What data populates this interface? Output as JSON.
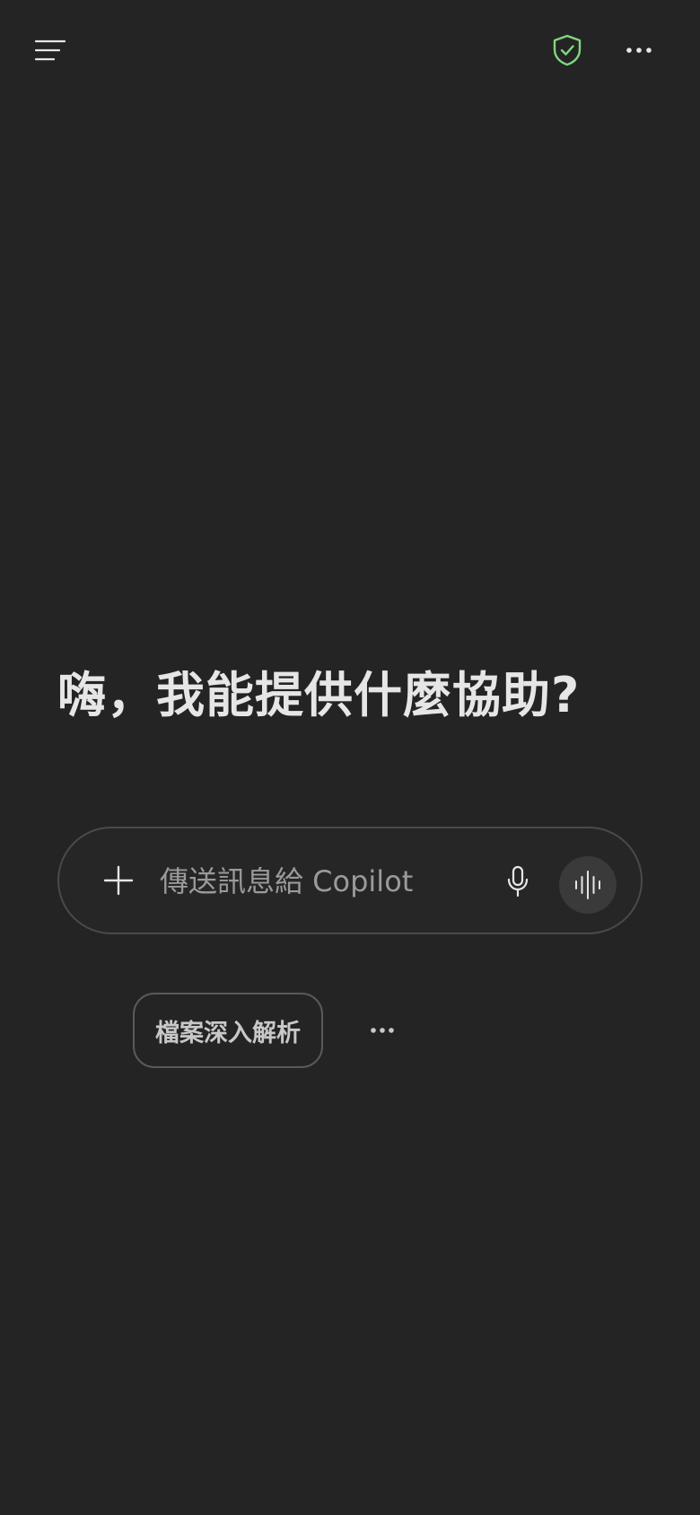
{
  "header": {
    "menu_icon": "menu-icon",
    "privacy_icon": "shield-check-icon",
    "more_icon": "more-horizontal-icon"
  },
  "main": {
    "greeting": "嗨，我能提供什麼協助?"
  },
  "composer": {
    "placeholder": "傳送訊息給 Copilot",
    "value": "",
    "add_icon": "plus-icon",
    "mic_icon": "microphone-icon",
    "voice_icon": "voice-waveform-icon"
  },
  "suggestions": {
    "chips": [
      {
        "label": "檔案深入解析"
      }
    ],
    "more_icon": "more-horizontal-icon"
  },
  "colors": {
    "background": "#242424",
    "text": "#e6e6e6",
    "placeholder": "#9a9a9a",
    "border": "#4a4a4a",
    "shield_accent": "#7fd67f",
    "voice_button_bg": "#3a3a3a"
  }
}
